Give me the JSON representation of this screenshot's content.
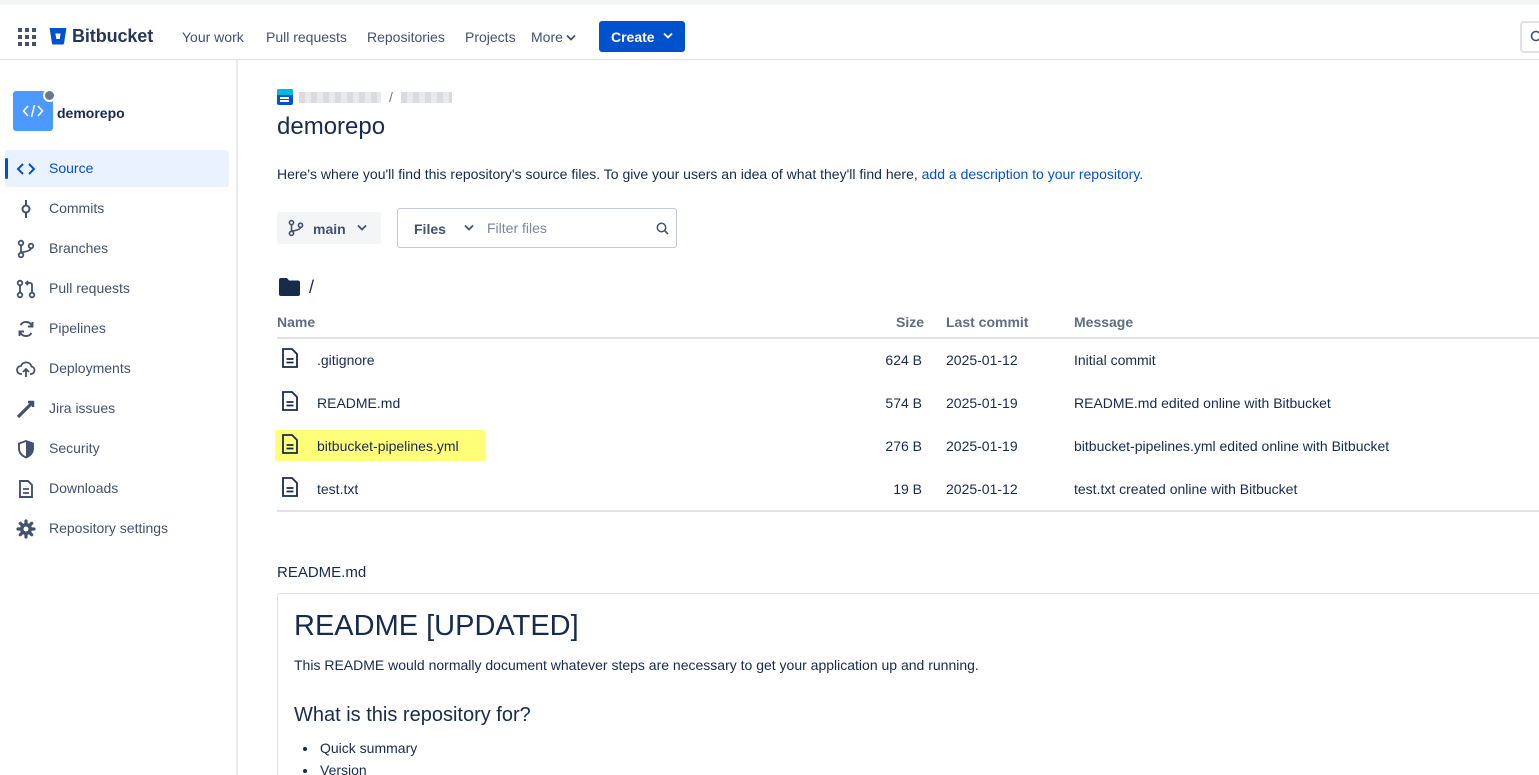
{
  "topnav": {
    "logo_text": "Bitbucket",
    "items": [
      "Your work",
      "Pull requests",
      "Repositories",
      "Projects"
    ],
    "more_label": "More",
    "create_label": "Create"
  },
  "sidebar": {
    "repo_name": "demorepo",
    "items": [
      {
        "label": "Source",
        "icon": "code-icon",
        "active": true
      },
      {
        "label": "Commits",
        "icon": "commit-icon"
      },
      {
        "label": "Branches",
        "icon": "branch-icon"
      },
      {
        "label": "Pull requests",
        "icon": "pull-request-icon"
      },
      {
        "label": "Pipelines",
        "icon": "pipelines-icon"
      },
      {
        "label": "Deployments",
        "icon": "cloud-upload-icon"
      },
      {
        "label": "Jira issues",
        "icon": "jira-icon"
      },
      {
        "label": "Security",
        "icon": "shield-icon"
      },
      {
        "label": "Downloads",
        "icon": "download-file-icon"
      },
      {
        "label": "Repository settings",
        "icon": "gear-icon"
      }
    ]
  },
  "main": {
    "crumb_sep": "/",
    "title": "demorepo",
    "description_prefix": "Here's where you'll find this repository's source files. To give your users an idea of what they'll find here, ",
    "description_link": "add a description to your repository",
    "description_suffix": ".",
    "branch": "main",
    "filter_mode": "Files",
    "filter_placeholder": "Filter files",
    "path": "/",
    "columns": {
      "name": "Name",
      "size": "Size",
      "last_commit": "Last commit",
      "message": "Message"
    },
    "files": [
      {
        "name": ".gitignore",
        "size": "624 B",
        "date": "2025-01-12",
        "message": "Initial commit",
        "highlighted": false
      },
      {
        "name": "README.md",
        "size": "574 B",
        "date": "2025-01-19",
        "message": "README.md edited online with Bitbucket",
        "highlighted": false
      },
      {
        "name": "bitbucket-pipelines.yml",
        "size": "276 B",
        "date": "2025-01-19",
        "message": "bitbucket-pipelines.yml edited online with Bitbucket",
        "highlighted": true
      },
      {
        "name": "test.txt",
        "size": "19 B",
        "date": "2025-01-12",
        "message": "test.txt created online with Bitbucket",
        "highlighted": false
      }
    ],
    "highlight_color": "#ffff7a"
  },
  "readme": {
    "label": "README.md",
    "h1": "README [UPDATED]",
    "p": "This README would normally document whatever steps are necessary to get your application up and running.",
    "h2": "What is this repository for?",
    "bullets": [
      "Quick summary",
      "Version"
    ]
  },
  "colors": {
    "accent": "#0052cc",
    "text": "#172b4d",
    "muted": "#42526e"
  }
}
